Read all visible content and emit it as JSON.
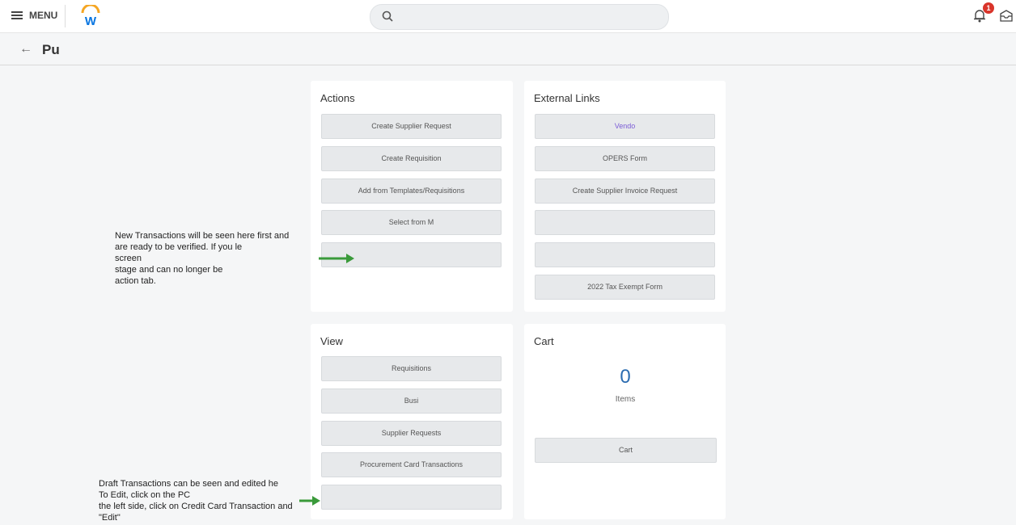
{
  "header": {
    "menu_label": "MENU",
    "search_placeholder": "",
    "notification_count": "1"
  },
  "page": {
    "title": "Pu"
  },
  "actions": {
    "title": "Actions",
    "buttons": [
      "Create Supplier Request",
      "Create Requisition",
      "Add from Templates/Requisitions",
      "Select from M",
      ""
    ]
  },
  "external_links": {
    "title": "External Links",
    "links": [
      "Vendo",
      "OPERS Form",
      "Create Supplier Invoice Request",
      "",
      "",
      "2022 Tax Exempt Form"
    ]
  },
  "view": {
    "title": "View",
    "buttons": [
      "Requisitions",
      "Busi",
      "Supplier Requests",
      "Procurement Card Transactions",
      ""
    ]
  },
  "cart": {
    "title": "Cart",
    "count": "0",
    "items_label": "Items",
    "button_label": "Cart"
  },
  "annotations": {
    "top_note": [
      "New Transactions will be seen here first and",
      "are ready to be verified. If you le",
      "screen",
      "stage and can no longer be",
      "action tab."
    ],
    "bottom_note": [
      "Draft Transactions can be seen and edited he",
      "To Edit, click on the PC",
      "the left side, click on Credit Card Transaction and",
      "\"Edit\""
    ]
  },
  "colors": {
    "accent": "#0875e1",
    "logo_orange": "#f5a623",
    "badge": "#d9352b",
    "arrow": "#3a9a3a"
  }
}
